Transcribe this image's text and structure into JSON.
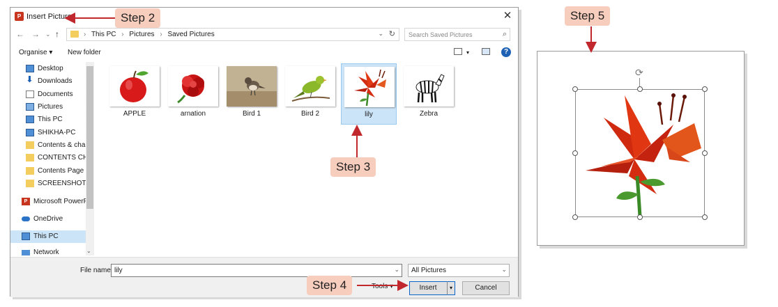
{
  "dialog": {
    "title": "Insert Picture",
    "app_badge": "P",
    "close_glyph": "✕",
    "address": {
      "crumbs": [
        "This PC",
        "Pictures",
        "Saved Pictures"
      ],
      "separator": "›"
    },
    "search_placeholder": "Search Saved Pictures",
    "toolbar": {
      "organise": "Organise ▾",
      "new_folder": "New folder",
      "help": "?"
    },
    "sidebar": {
      "quick_access": [
        {
          "label": "Desktop",
          "icon": "monitor-icon",
          "pinned": true
        },
        {
          "label": "Downloads",
          "icon": "download-icon",
          "pinned": true
        },
        {
          "label": "Documents",
          "icon": "document-icon",
          "pinned": true
        },
        {
          "label": "Pictures",
          "icon": "pictures-icon",
          "pinned": true
        },
        {
          "label": "This PC",
          "icon": "monitor-icon",
          "pinned": true
        },
        {
          "label": "SHIKHA-PC",
          "icon": "monitor-icon",
          "pinned": true
        },
        {
          "label": "Contents & chap",
          "icon": "folder-icon",
          "pinned": false
        },
        {
          "label": "CONTENTS CHA",
          "icon": "folder-icon",
          "pinned": false
        },
        {
          "label": "Contents Page a",
          "icon": "folder-icon",
          "pinned": false
        },
        {
          "label": "SCREENSHOTS (",
          "icon": "folder-icon",
          "pinned": false
        }
      ],
      "locations": [
        {
          "label": "Microsoft PowerP",
          "icon": "powerpoint-icon"
        },
        {
          "label": "OneDrive",
          "icon": "cloud-icon"
        },
        {
          "label": "This PC",
          "icon": "monitor-icon",
          "selected": true
        },
        {
          "label": "Network",
          "icon": "network-icon"
        }
      ]
    },
    "files": [
      {
        "name": "APPLE",
        "icon": "apple-icon"
      },
      {
        "name": "arnation",
        "icon": "carnation-icon"
      },
      {
        "name": "Bird 1",
        "icon": "sparrow-icon"
      },
      {
        "name": "Bird 2",
        "icon": "green-bird-icon"
      },
      {
        "name": "lily",
        "icon": "lily-icon",
        "selected": true
      },
      {
        "name": "Zebra",
        "icon": "zebra-icon"
      }
    ],
    "footer": {
      "file_name_label": "File name:",
      "file_name_value": "lily",
      "filter": "All Pictures",
      "tools": "Tools  ▾",
      "insert": "Insert",
      "cancel": "Cancel"
    }
  },
  "steps": [
    "Step 2",
    "Step 3",
    "Step 4",
    "Step 5"
  ],
  "colors": {
    "arrow": "#c0282e",
    "callout": "#f7cdbd",
    "selection": "#cce4f7"
  }
}
